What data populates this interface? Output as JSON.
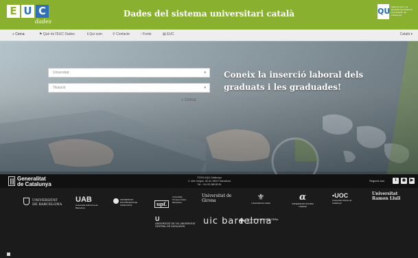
{
  "header": {
    "logo_letters": [
      "E",
      "U",
      "C"
    ],
    "logo_sub": "dades",
    "title": "Dades del sistema universitari català",
    "aqu_logo": "QU",
    "aqu_text": "Agència per a la Qualitat del Sistema Universitari de Catalunya"
  },
  "nav": {
    "items": [
      {
        "icon": "search-icon",
        "glyph": "⌕",
        "label": "Cerca"
      },
      {
        "icon": "people-icon",
        "glyph": "⚑",
        "label": "Què és l'EUC Dades"
      },
      {
        "icon": "info-icon",
        "glyph": "ℹ",
        "label": "Qui som"
      },
      {
        "icon": "location-icon",
        "glyph": "⚲",
        "label": "Contacte"
      },
      {
        "icon": "book-icon",
        "glyph": "⁝",
        "label": "Fonts"
      },
      {
        "icon": "document-icon",
        "glyph": "▤",
        "label": "EUC"
      }
    ],
    "language": "Català"
  },
  "hero": {
    "university_placeholder": "Universitat",
    "degree_placeholder": "Titulació",
    "search_label": "Cerca",
    "headline_line1": "Coneix la inserció laboral dels",
    "headline_line2": "graduats i les graduades!"
  },
  "footer": {
    "generalitat_line1": "Generalitat",
    "generalitat_line2": "de Catalunya",
    "center_line1": "©2016 AQU Catalunya",
    "center_line2": "C. dels Vergós, 36-42, 08017 Barcelona",
    "center_line3": "Tel.: +34 93 268 89 50",
    "follow": "Segueix-nos",
    "social": [
      "twitter-icon",
      "rss-icon",
      "youtube-icon"
    ]
  },
  "universities": [
    {
      "name": "UNIVERSITAT DE BARCELONA"
    },
    {
      "name": "UAB",
      "sub": "Universitat Autònoma de Barcelona"
    },
    {
      "name": "UNIVERSITAT POLITÈCNICA DE CATALUNYA"
    },
    {
      "name": "upf.",
      "sub": "Universitat Pompeu Fabra Barcelona"
    },
    {
      "name": "Universitat de Girona"
    },
    {
      "name": "Universitat de Lleida"
    },
    {
      "name": "UNIVERSITAT ROVIRA I VIRGILI"
    },
    {
      "name": "UOC",
      "sub": "Universitat Oberta de Catalunya"
    },
    {
      "name": "Universitat Ramon Llull"
    },
    {
      "name": "UNIVERSITAT DE VIC UNIVERSITAT CENTRAL DE CATALUNYA"
    },
    {
      "name": "uic barcelona"
    },
    {
      "name": "Universitat Abat Oliba CEU"
    }
  ],
  "colors": {
    "header_green": "#89b12f",
    "logo_blue": "#2f70b8",
    "footer_dark": "#1b1b1b"
  }
}
